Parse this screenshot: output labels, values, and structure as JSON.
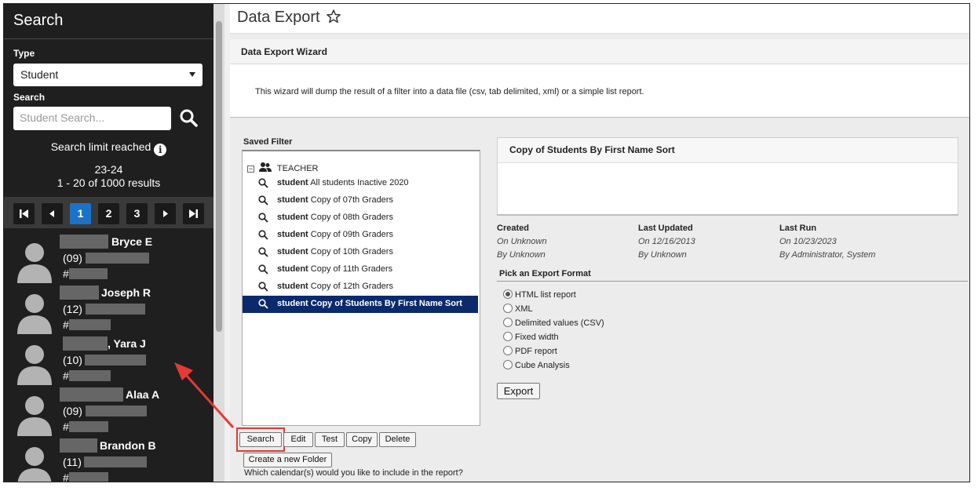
{
  "sidebar": {
    "title": "Search",
    "type_label": "Type",
    "type_value": "Student",
    "search_label": "Search",
    "search_placeholder": "Student Search...",
    "limit_text": "Search limit reached",
    "school_year": "23-24",
    "results_text": "1 - 20 of 1000 results",
    "pages": [
      "1",
      "2",
      "3"
    ],
    "students": [
      {
        "name": "Bryce E",
        "grade": "(09)",
        "hash": "#"
      },
      {
        "name": "Joseph R",
        "grade": "(12)",
        "hash": "#"
      },
      {
        "name": ", Yara J",
        "grade": "(10)",
        "hash": "#"
      },
      {
        "name": "Alaa A",
        "grade": "(09)",
        "hash": "#"
      },
      {
        "name": "Brandon B",
        "grade": "(11)",
        "hash": "#"
      }
    ]
  },
  "main": {
    "page_title": "Data Export",
    "wizard_title": "Data Export Wizard",
    "wizard_description": "This wizard will dump the result of a filter into a data file (csv, tab delimited, xml) or a simple list report.",
    "saved_filter_label": "Saved Filter",
    "folder_name": "TEACHER",
    "filters": [
      {
        "prefix": "student",
        "name": "All students Inactive 2020"
      },
      {
        "prefix": "student",
        "name": "Copy of 07th Graders"
      },
      {
        "prefix": "student",
        "name": "Copy of 08th Graders"
      },
      {
        "prefix": "student",
        "name": "Copy of 09th Graders"
      },
      {
        "prefix": "student",
        "name": "Copy of 10th Graders"
      },
      {
        "prefix": "student",
        "name": "Copy of 11th Graders"
      },
      {
        "prefix": "student",
        "name": "Copy of 12th Graders"
      },
      {
        "prefix": "student",
        "name": "Copy of Students By First Name Sort"
      }
    ],
    "buttons": {
      "search": "Search",
      "edit": "Edit",
      "test": "Test",
      "copy": "Copy",
      "delete": "Delete",
      "new_folder": "Create a new Folder"
    },
    "calendar_question": "Which calendar(s) would you like to include in the report?",
    "detail": {
      "title": "Copy of Students By First Name Sort",
      "created_label": "Created",
      "created_on": "On Unknown",
      "created_by": "By Unknown",
      "updated_label": "Last Updated",
      "updated_on": "On 12/16/2013",
      "updated_by": "By Unknown",
      "run_label": "Last Run",
      "run_on": "On 10/23/2023",
      "run_by": "By Administrator, System"
    },
    "export_format_label": "Pick an Export Format",
    "formats": [
      "HTML list report",
      "XML",
      "Delimited values (CSV)",
      "Fixed width",
      "PDF report",
      "Cube Analysis"
    ],
    "selected_format": "HTML list report",
    "export_button": "Export"
  },
  "colors": {
    "sidebar_bg": "#1f1f1f",
    "active_page": "#1b73c9",
    "selected_row": "#0b2a6b",
    "annotation": "#e53935"
  }
}
